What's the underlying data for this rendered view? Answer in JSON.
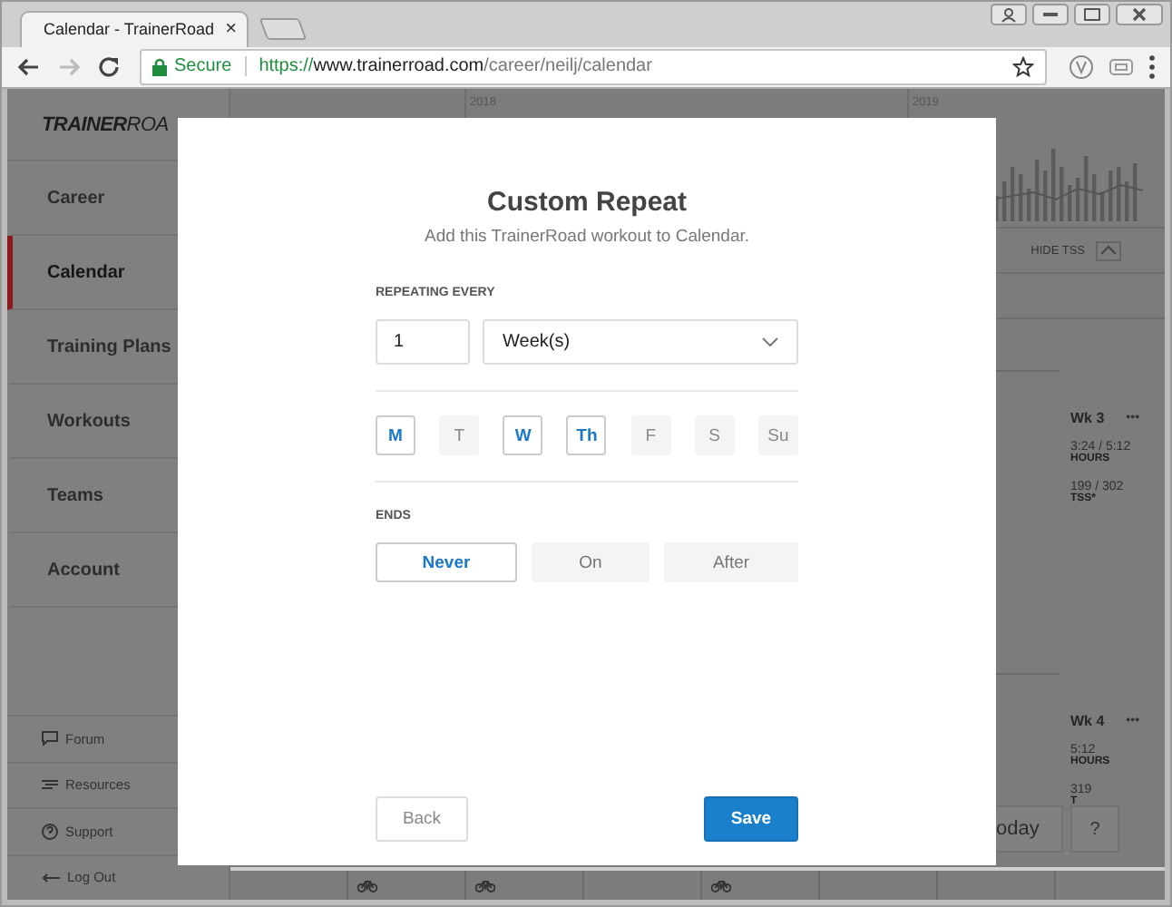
{
  "browser": {
    "tab": {
      "title": "Calendar - TrainerRoad",
      "close": "×"
    },
    "security": "Secure",
    "url": {
      "scheme": "https://",
      "host": "www.trainerroad.com",
      "path": "/career/neilj/calendar"
    }
  },
  "sidebar": {
    "logo": "**TRAINER**ROA",
    "items": [
      {
        "label": "Career",
        "selected": false
      },
      {
        "label": "Calendar",
        "selected": true
      },
      {
        "label": "Training Plans",
        "selected": false
      },
      {
        "label": "Workouts",
        "selected": false
      },
      {
        "label": "Teams",
        "selected": false
      },
      {
        "label": "Account",
        "selected": false
      }
    ],
    "footer_links": [
      "Forum",
      "Resources",
      "Support",
      "Log Out"
    ]
  },
  "calendar": {
    "years": [
      "2018",
      "2019"
    ],
    "hide_tss": "HIDE TSS",
    "weeks": [
      {
        "label": "Wk 3",
        "menu": "•••",
        "hours": "3:24 / 5:12",
        "hours_label": "HOURS",
        "tss": "199 / 302",
        "tss_label": "TSS*"
      },
      {
        "label": "Wk 4",
        "menu": "•••",
        "hours": "5:12",
        "hours_label": "HOURS",
        "tss": "319",
        "tss_label": "T"
      }
    ],
    "bottom_days": [
      {
        "has_workout": false
      },
      {
        "has_workout": true
      },
      {
        "has_workout": true
      },
      {
        "has_workout": false
      },
      {
        "has_workout": true
      },
      {
        "has_workout": false
      },
      {
        "has_workout": false
      }
    ],
    "today_button": "oday",
    "help_button": "?"
  },
  "modal": {
    "title": "Custom Repeat",
    "subtitle": "Add this TrainerRoad workout to Calendar.",
    "repeat_label": "REPEATING EVERY",
    "interval": "1",
    "unit": "Week(s)",
    "days": [
      {
        "label": "M",
        "selected": true
      },
      {
        "label": "T",
        "selected": false
      },
      {
        "label": "W",
        "selected": true
      },
      {
        "label": "Th",
        "selected": true
      },
      {
        "label": "F",
        "selected": false
      },
      {
        "label": "S",
        "selected": false
      },
      {
        "label": "Su",
        "selected": false
      }
    ],
    "ends_label": "ENDS",
    "ends": [
      {
        "label": "Never",
        "selected": true
      },
      {
        "label": "On",
        "selected": false
      },
      {
        "label": "After",
        "selected": false
      }
    ],
    "back": "Back",
    "save": "Save"
  }
}
